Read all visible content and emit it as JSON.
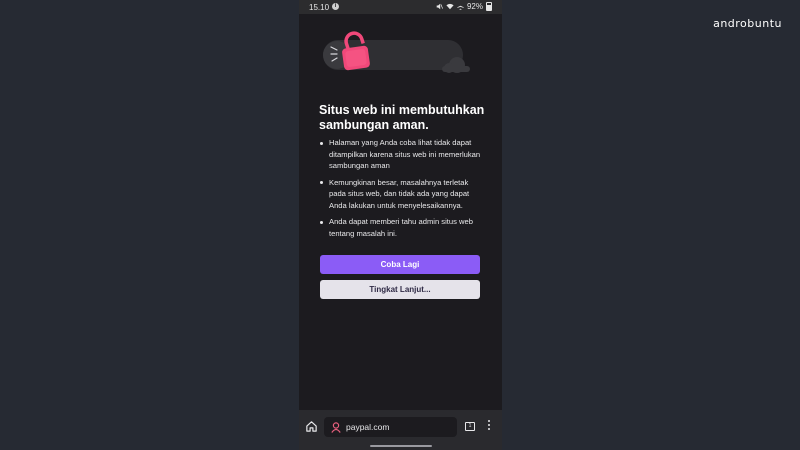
{
  "watermark": "androbuntu",
  "status_bar": {
    "time": "15.10",
    "info_glyph": "i",
    "battery": "92%",
    "icons": [
      "mute-icon",
      "wifi-icon",
      "airplane-icon",
      "battery-icon"
    ]
  },
  "error_page": {
    "illustration": "lock-icon",
    "headline": "Situs web ini membutuhkan sambungan aman.",
    "bullets": [
      "Halaman yang Anda coba lihat tidak dapat ditampilkan karena situs web ini memerlukan sambungan aman",
      "Kemungkinan besar, masalahnya terletak pada situs web, dan tidak ada yang dapat Anda lakukan untuk menyelesaikannya.",
      "Anda dapat memberi tahu admin situs web tentang masalah ini."
    ],
    "primary_button": "Coba Lagi",
    "secondary_button": "Tingkat Lanjut..."
  },
  "bottom_bar": {
    "url": "paypal.com",
    "tab_count": "1"
  },
  "colors": {
    "accent": "#8b5cf6",
    "lock": "#f0487a",
    "background": "#1c1b1f"
  }
}
